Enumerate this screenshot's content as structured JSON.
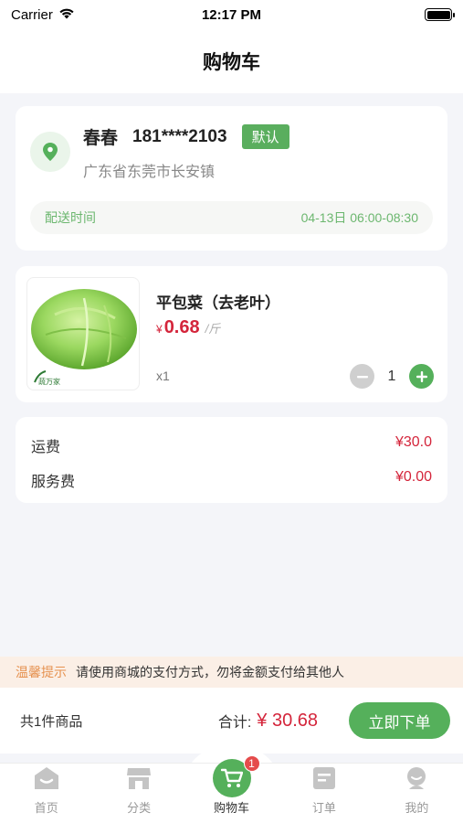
{
  "status_bar": {
    "carrier": "Carrier",
    "time": "12:17 PM"
  },
  "nav": {
    "title": "购物车"
  },
  "address": {
    "name": "春春",
    "phone": "181****2103",
    "default_badge": "默认",
    "detail": "广东省东莞市长安镇",
    "delivery_label": "配送时间",
    "delivery_time": "04-13日 06:00-08:30"
  },
  "product": {
    "name": "平包菜（去老叶）",
    "price_symbol": "¥",
    "price": "0.68",
    "unit": "/斤",
    "qty_text": "x1",
    "count": "1",
    "image_watermark": "蔬万家"
  },
  "fees": {
    "shipping_label": "运费",
    "shipping_value": "¥30.0",
    "service_label": "服务费",
    "service_value": "¥0.00"
  },
  "notice": {
    "label": "温馨提示",
    "text": "请使用商城的支付方式，勿将金额支付给其他人"
  },
  "checkout": {
    "item_count": "共1件商品",
    "total_label": "合计:",
    "total_value": "¥ 30.68",
    "order_button": "立即下单"
  },
  "tabs": [
    {
      "label": "首页",
      "icon": "home-icon"
    },
    {
      "label": "分类",
      "icon": "store-icon"
    },
    {
      "label": "购物车",
      "icon": "cart-icon",
      "badge": "1",
      "active": true
    },
    {
      "label": "订单",
      "icon": "order-icon"
    },
    {
      "label": "我的",
      "icon": "profile-icon"
    }
  ],
  "colors": {
    "accent": "#55b05b",
    "price": "#d4253b",
    "notice": "#e6914f"
  }
}
